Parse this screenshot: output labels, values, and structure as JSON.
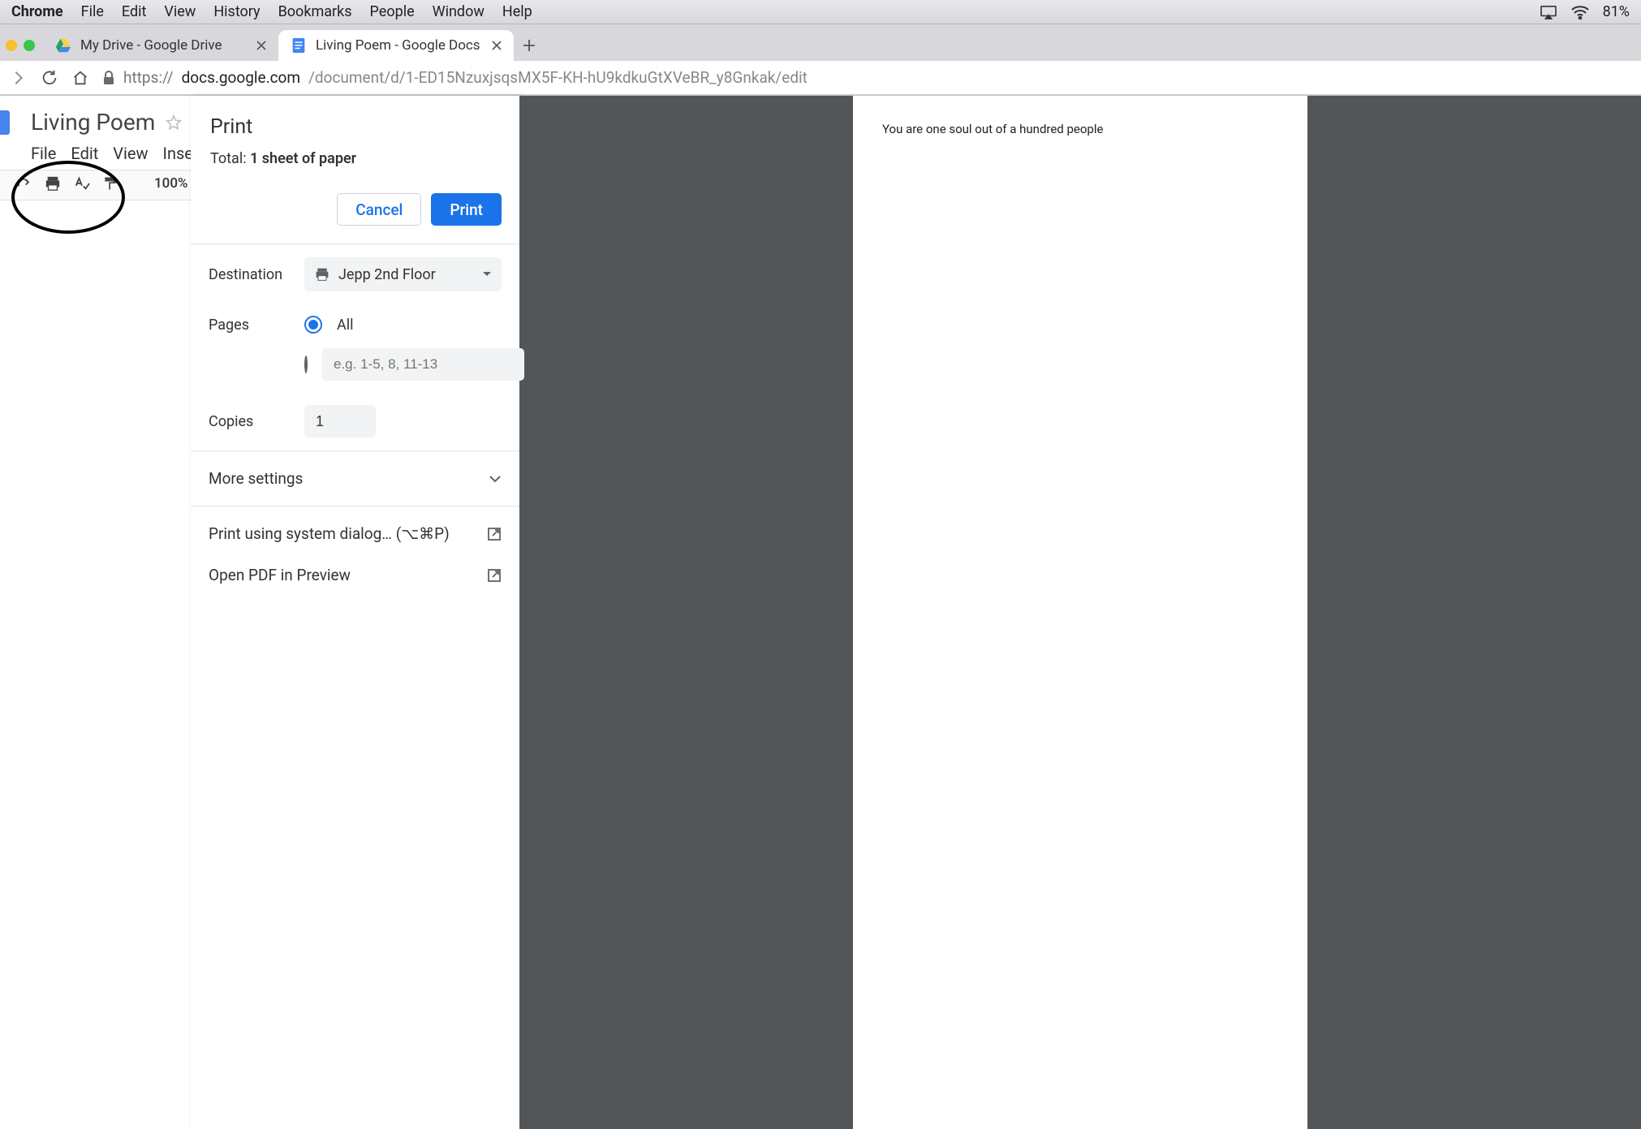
{
  "menubar": {
    "app": "Chrome",
    "items": [
      "File",
      "Edit",
      "View",
      "History",
      "Bookmarks",
      "People",
      "Window",
      "Help"
    ],
    "battery": "81%"
  },
  "tabs": {
    "t1": "My Drive - Google Drive",
    "t2": "Living Poem - Google Docs"
  },
  "url": {
    "proto": "https://",
    "host": "docs.google.com",
    "path": "/document/d/1-ED15NzuxjsqsMX5F-KH-hU9kdkuGtXVeBR_y8Gnkak/edit"
  },
  "docs": {
    "title": "Living Poem",
    "menus": [
      "File",
      "Edit",
      "View",
      "Inse"
    ],
    "zoom": "100%"
  },
  "print": {
    "title": "Print",
    "total_prefix": "Total: ",
    "total_bold": "1 sheet of paper",
    "cancel": "Cancel",
    "print_btn": "Print",
    "dest_label": "Destination",
    "dest_value": "Jepp 2nd Floor",
    "pages_label": "Pages",
    "pages_all": "All",
    "pages_placeholder": "e.g. 1-5, 8, 11-13",
    "copies_label": "Copies",
    "copies_value": "1",
    "more": "More settings",
    "sysdialog": "Print using system dialog… (⌥⌘P)",
    "openpdf": "Open PDF in Preview"
  },
  "preview": {
    "line1": "You are one soul out of a hundred people"
  }
}
